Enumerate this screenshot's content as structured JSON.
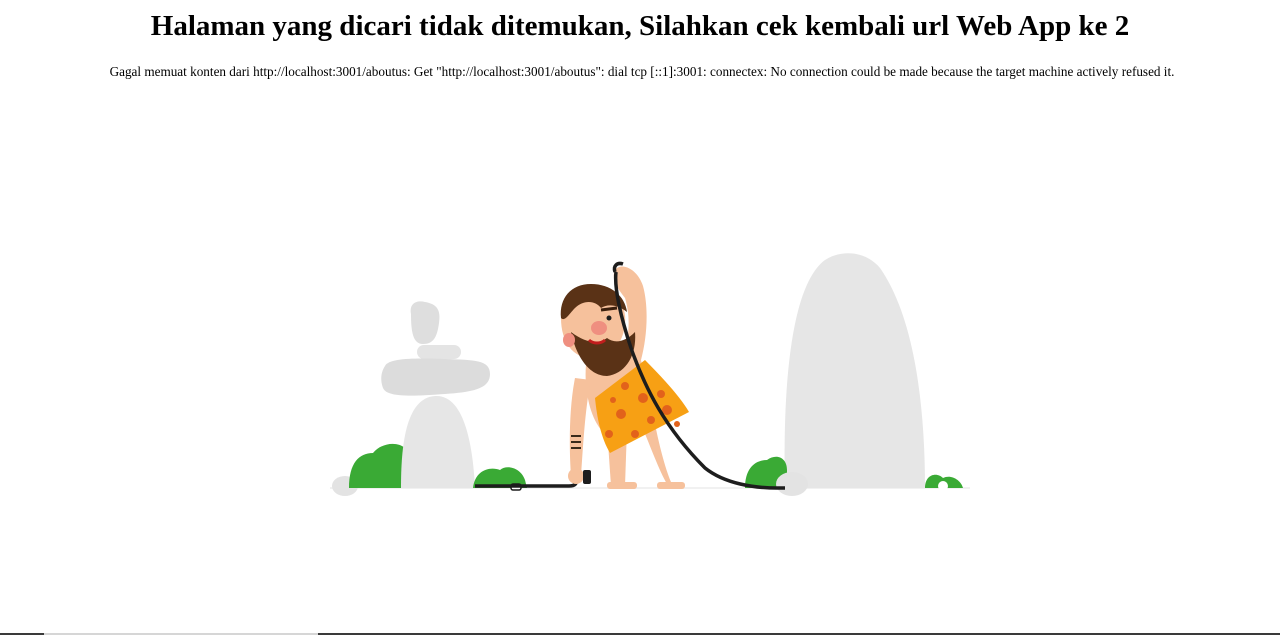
{
  "error": {
    "title": "Halaman yang dicari tidak ditemukan, Silahkan cek kembali url Web App ke 2",
    "message": "Gagal memuat konten dari http://localhost:3001/aboutus: Get \"http://localhost:3001/aboutus\": dial tcp [::1]:3001: connectex: No connection could be made because the target machine actively refused it."
  },
  "illustration": {
    "icon": "caveman-unplugged-cable-illustration",
    "colors": {
      "rock": "#e3e3e3",
      "bush": "#3aaa35",
      "skin": "#f6c19c",
      "hair": "#5a3216",
      "outfit": "#f7a014",
      "outfit_spots": "#e2621b",
      "cable": "#1d1d1d"
    }
  }
}
